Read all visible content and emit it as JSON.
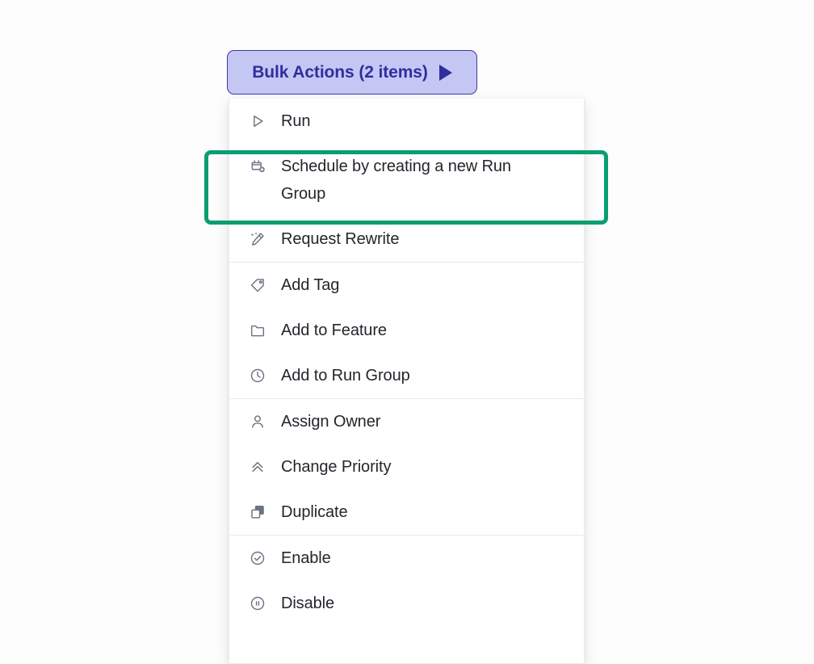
{
  "theme": {
    "page_background": "#fdfdfd",
    "button_background": "#c4c7f4",
    "button_border": "#3b37a3",
    "button_text": "#2f2e9e",
    "menu_background": "#ffffff",
    "menu_text": "#23262c",
    "icon_color": "#6b7280",
    "divider": "#e9e9ec",
    "highlight_outline": "#0a9e72"
  },
  "trigger": {
    "label": "Bulk Actions (2 items)",
    "selected_count": 2,
    "caret_icon": "caret-right-icon",
    "expanded": true
  },
  "menu": {
    "groups": [
      {
        "name": "primary-actions",
        "items": [
          {
            "label": "Run",
            "icon": "play-outline-icon",
            "highlighted": false
          },
          {
            "label": "Schedule by creating a new Run Group",
            "icon": "calendar-plus-icon",
            "highlighted": true
          },
          {
            "label": "Request Rewrite",
            "icon": "magic-pencil-icon",
            "highlighted": false
          }
        ]
      },
      {
        "name": "organize-actions",
        "items": [
          {
            "label": "Add Tag",
            "icon": "tag-icon",
            "highlighted": false
          },
          {
            "label": "Add to Feature",
            "icon": "folder-icon",
            "highlighted": false
          },
          {
            "label": "Add to Run Group",
            "icon": "clock-icon",
            "highlighted": false
          }
        ]
      },
      {
        "name": "metadata-actions",
        "items": [
          {
            "label": "Assign Owner",
            "icon": "user-icon",
            "highlighted": false
          },
          {
            "label": "Change Priority",
            "icon": "chevrons-up-icon",
            "highlighted": false
          },
          {
            "label": "Duplicate",
            "icon": "copy-icon",
            "highlighted": false
          }
        ]
      },
      {
        "name": "state-actions",
        "items": [
          {
            "label": "Enable",
            "icon": "check-circle-icon",
            "highlighted": false
          },
          {
            "label": "Disable",
            "icon": "pause-circle-icon",
            "highlighted": false
          }
        ]
      }
    ]
  },
  "annotation": {
    "type": "highlight-box",
    "target_label": "Schedule by creating a new Run Group",
    "color": "#0a9e72"
  }
}
